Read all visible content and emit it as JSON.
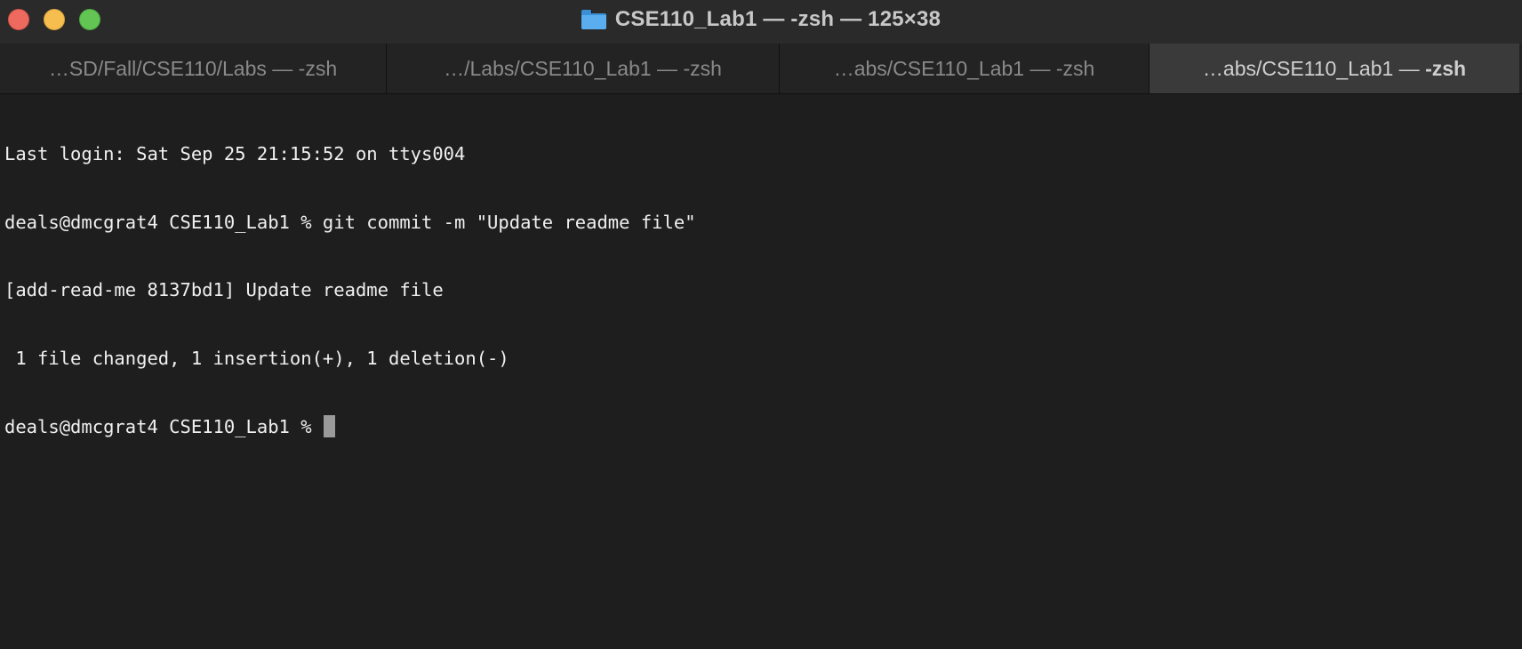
{
  "window": {
    "title": "CSE110_Lab1 — -zsh — 125×38",
    "folder_icon": "folder-icon"
  },
  "tabs": [
    {
      "label": "…SD/Fall/CSE110/Labs — -zsh",
      "active": false
    },
    {
      "label": "…/Labs/CSE110_Lab1 — -zsh",
      "active": false
    },
    {
      "label": "…abs/CSE110_Lab1 — -zsh",
      "active": false
    },
    {
      "label_prefix": "…abs/CSE110_Lab1 — ",
      "label_suffix": "-zsh",
      "active": true
    }
  ],
  "terminal": {
    "lines": [
      "Last login: Sat Sep 25 21:15:52 on ttys004",
      "deals@dmcgrat4 CSE110_Lab1 % git commit -m \"Update readme file\"",
      "[add-read-me 8137bd1] Update readme file",
      " 1 file changed, 1 insertion(+), 1 deletion(-)"
    ],
    "prompt": "deals@dmcgrat4 CSE110_Lab1 % "
  },
  "colors": {
    "background": "#1e1e1e",
    "text": "#f0f0f0",
    "close": "#ee6a5f",
    "minimize": "#f5be4f",
    "maximize": "#62c554",
    "active_tab": "#3a3a3a"
  }
}
